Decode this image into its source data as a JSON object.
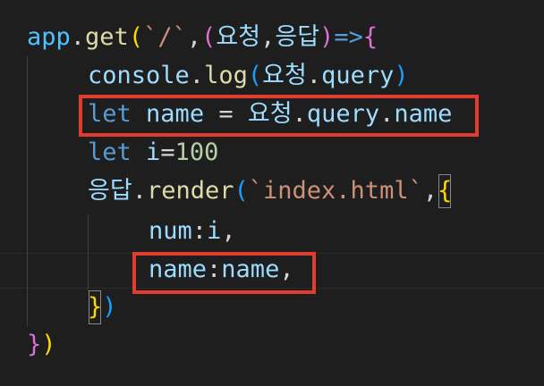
{
  "code": {
    "line1": {
      "obj": "app",
      "dot": ".",
      "method": "get",
      "open_paren": "(",
      "path": "`/`",
      "comma": ",",
      "params_open": "(",
      "param_req": "요청",
      "param_comma": ",",
      "param_res": "응답",
      "params_close": ")",
      "arrow": "=>",
      "brace_open": "{"
    },
    "line2": {
      "obj": "console",
      "dot": ".",
      "method": "log",
      "open_paren": "(",
      "arg_obj": "요청",
      "arg_dot": ".",
      "arg_prop": "query",
      "close_paren": ")"
    },
    "line3": {
      "keyword": "let",
      "var": "name",
      "eq": " = ",
      "obj": "요청",
      "dot1": ".",
      "prop1": "query",
      "dot2": ".",
      "prop2": "name"
    },
    "line4": {
      "keyword": "let",
      "var": "i",
      "eq": "=",
      "num": "100"
    },
    "line5": {
      "obj": "응답",
      "dot": ".",
      "method": "render",
      "open_paren": "(",
      "template": "`index.html`",
      "comma": ",",
      "brace_open": "{"
    },
    "line6": {
      "key": "num",
      "colon": ":",
      "value": "i",
      "comma": ","
    },
    "line7": {
      "key": "name",
      "colon": ":",
      "value": "name",
      "comma": ","
    },
    "line8": {
      "brace_close": "}",
      "paren_close": ")"
    },
    "line9": {
      "brace_close": "}",
      "paren_close": ")"
    }
  },
  "colors": {
    "background": "#1e1e1e",
    "highlight_box": "#e03c2f",
    "keyword": "#569cd6",
    "variable": "#9cdcfe",
    "function": "#dcdcaa",
    "string": "#ce9178",
    "number": "#b5cea8"
  }
}
